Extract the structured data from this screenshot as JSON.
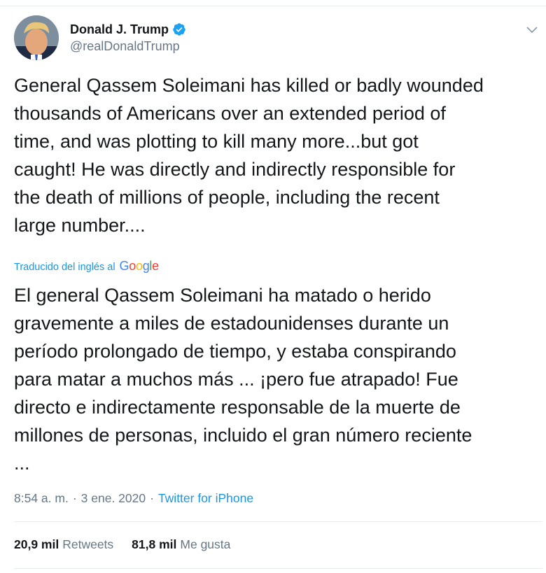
{
  "author": {
    "display_name": "Donald J. Trump",
    "handle": "@realDonaldTrump",
    "avatar_icon": "avatar-portrait",
    "verified_icon": "verified-badge-icon"
  },
  "tweet": {
    "text": "General Qassem Soleimani has killed or badly wounded\nthousands of Americans over an extended period of\ntime, and was plotting to kill many more...but got\ncaught! He was directly and indirectly responsible for\nthe death of millions of people, including the recent\nlarge number....",
    "translation_label": "Traducido del inglés al",
    "translation_provider": "Google",
    "translated_text": "El general Qassem Soleimani ha matado o herido\ngravemente a miles de estadounidenses durante un\nperíodo prolongado de tiempo, y estaba conspirando\npara matar a muchos más ... ¡pero fue atrapado! Fue\ndirecto e indirectamente responsable de la muerte de\nmillones de personas, incluido el gran número reciente\n...",
    "time": "8:54 a. m.",
    "separator": "·",
    "date": "3 ene. 2020",
    "source": "Twitter for iPhone"
  },
  "stats": {
    "retweets_count": "20,9 mil",
    "retweets_label": "Retweets",
    "likes_count": "81,8 mil",
    "likes_label": "Me gusta"
  },
  "colors": {
    "link": "#1b95e0",
    "secondary_text": "#657786",
    "primary_text": "#14171a",
    "verified": "#1da1f2"
  }
}
